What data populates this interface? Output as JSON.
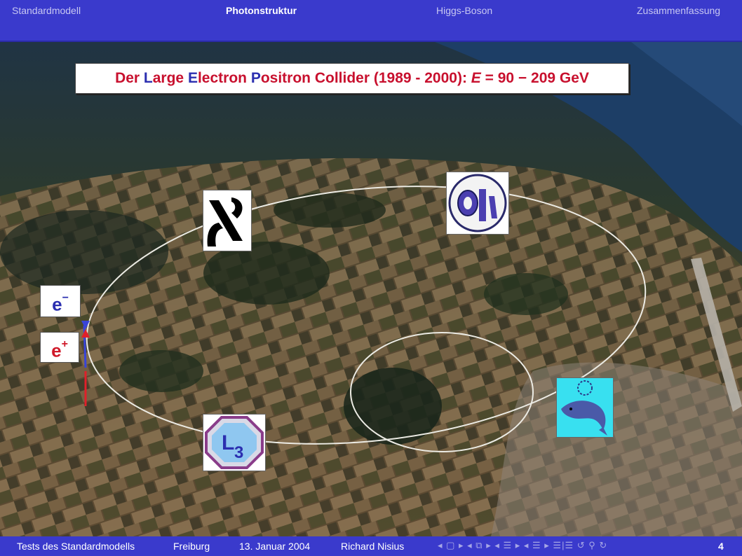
{
  "header": {
    "sections": [
      {
        "label": "Standardmodell",
        "active": false
      },
      {
        "label": "Photonstruktur",
        "active": true
      },
      {
        "label": "Higgs-Boson",
        "active": false
      },
      {
        "label": "Zusammenfassung",
        "active": false
      }
    ]
  },
  "title": {
    "w1a": "Der ",
    "w1b": "L",
    "w1c": "arge ",
    "w2a": "E",
    "w2b": "lectron ",
    "w3a": "P",
    "w3b": "ositron ",
    "w4": "C",
    "w5": "ollider (1989 - 2000): ",
    "formula_e": "E",
    "formula_rest": " = 90 − 209 ",
    "unit": "GeV"
  },
  "labels": {
    "electron": "e",
    "electron_sup": "−",
    "positron": "e",
    "positron_sup": "+"
  },
  "logos": {
    "aleph": "aleph-logo",
    "opal": "opal-logo",
    "l3": "l3-logo",
    "delphi": "delphi-logo"
  },
  "footer": {
    "talk": "Tests des Standardmodells",
    "place": "Freiburg",
    "date": "13. Januar 2004",
    "author": "Richard Nisius",
    "nav_symbols": "◂ ▢ ▸ ◂ ⧉ ▸ ◂ ☰ ▸ ◂ ☰ ▸ ☰|☰ ↺ ⚲ ↻",
    "page": "4"
  },
  "colors": {
    "bar": "#3a3acc",
    "title_red": "#c8102e",
    "title_blue": "#2b2fb0"
  }
}
